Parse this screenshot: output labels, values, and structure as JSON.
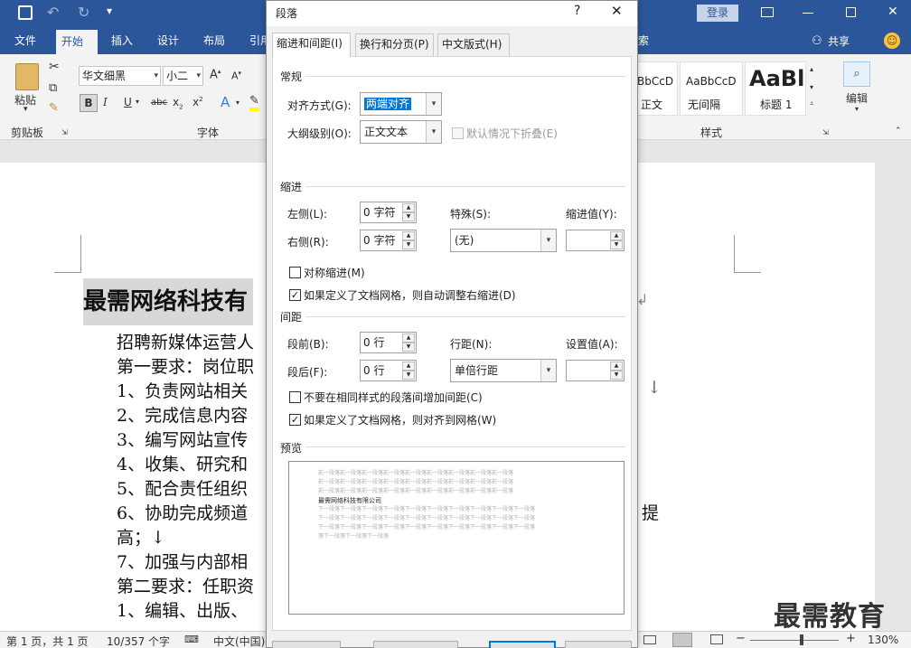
{
  "window": {
    "login_label": "登录"
  },
  "tabs": [
    "文件",
    "开始",
    "插入",
    "设计",
    "布局",
    "引用",
    "索"
  ],
  "tabs_right": {
    "share": "共享"
  },
  "ribbon": {
    "paste": "粘贴",
    "font_name": "华文细黑",
    "font_size": "小二",
    "group_clipboard": "剪贴板",
    "group_font": "字体",
    "group_styles": "样式",
    "group_edit": "编辑",
    "styles": [
      {
        "preview": "BbCcD",
        "name": "正文"
      },
      {
        "preview": "AaBbCcD",
        "name": "无间隔"
      },
      {
        "preview": "AaBl",
        "name": "标题 1"
      }
    ]
  },
  "document": {
    "heading": "最需网络科技有",
    "lines": [
      "招聘新媒体运营人",
      "第一要求：岗位职",
      "1、负责网站相关",
      "2、完成信息内容",
      "3、编写网站宣传",
      "4、收集、研究和",
      "5、配合责任组织",
      "6、协助完成频道",
      "高；↓",
      "7、加强与内部相",
      "第二要求：任职资",
      "1、编辑、出版、"
    ],
    "right_fragments": {
      "mark1": "↓",
      "mark2": "提"
    }
  },
  "status": {
    "page": "第 1 页，共 1 页",
    "words": "10/357 个字",
    "lang": "中文(中国)",
    "zoom": "130%"
  },
  "watermark": "最需教育",
  "dialog": {
    "title": "段落",
    "help": "?",
    "close": "✕",
    "tabs": [
      "缩进和间距(I)",
      "换行和分页(P)",
      "中文版式(H)"
    ],
    "general": {
      "section": "常规",
      "align_label": "对齐方式(G):",
      "align_value": "两端对齐",
      "outline_label": "大纲级别(O):",
      "outline_value": "正文文本",
      "collapse_label": "默认情况下折叠(E)"
    },
    "indent": {
      "section": "缩进",
      "left_label": "左侧(L):",
      "left_value": "0 字符",
      "right_label": "右侧(R):",
      "right_value": "0 字符",
      "special_label": "特殊(S):",
      "special_value": "(无)",
      "by_label": "缩进值(Y):",
      "mirror_label": "对称缩进(M)",
      "auto_label": "如果定义了文档网格，则自动调整右缩进(D)"
    },
    "spacing": {
      "section": "间距",
      "before_label": "段前(B):",
      "before_value": "0 行",
      "after_label": "段后(F):",
      "after_value": "0 行",
      "line_label": "行距(N):",
      "line_value": "单倍行距",
      "at_label": "设置值(A):",
      "nospace_label": "不要在相同样式的段落间增加间距(C)",
      "snap_label": "如果定义了文档网格，则对齐到网格(W)"
    },
    "preview": {
      "section": "预览",
      "prev": "前一段落前一段落前一段落前一段落前一段落前一段落前一段落前一段落前一段落",
      "sample": "最需网络科技有限公司",
      "next": "下一段落下一段落下一段落下一段落下一段落下一段落下一段落下一段落下一段落下一段落",
      "next_end": "落下一段落下一段落下一段落"
    },
    "checks": {
      "mirror": false,
      "auto": true,
      "nospace": false,
      "snap": true
    }
  }
}
